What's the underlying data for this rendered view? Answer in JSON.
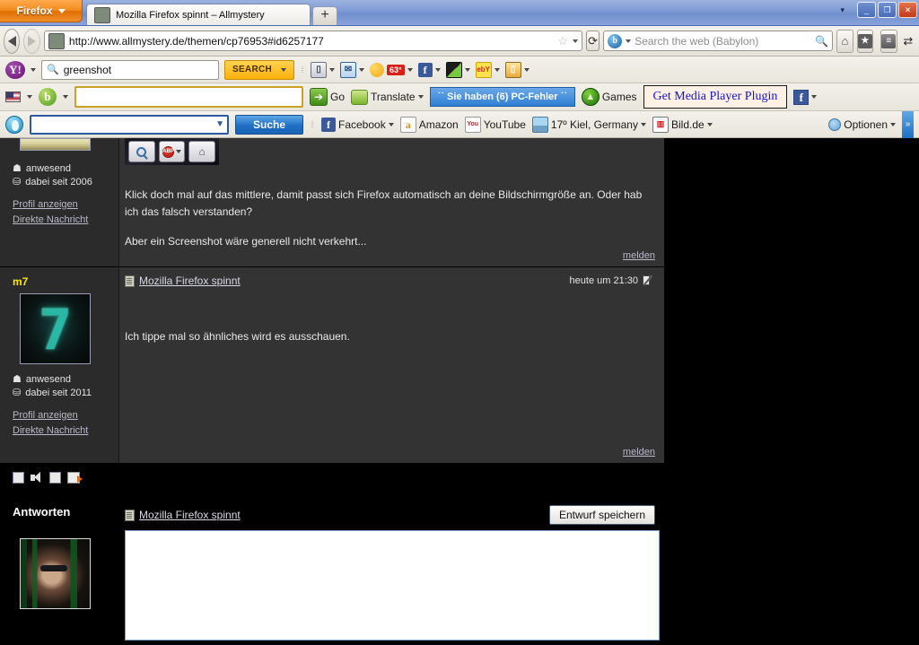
{
  "browser": {
    "app_button": "Firefox",
    "tab_title": "Mozilla Firefox spinnt – Allmystery",
    "new_tab": "+",
    "minimize": "_",
    "maximize": "❐",
    "close": "✕",
    "url": "http://www.allmystery.de/themen/cp76953#id6257177",
    "search_placeholder": "Search the web (Babylon)",
    "search_engine": "b"
  },
  "yahoo_toolbar": {
    "logo": "Y!",
    "query": "greenshot",
    "search_button": "SEARCH",
    "icons": [
      {
        "name": "bookmarks-icon",
        "label": ""
      },
      {
        "name": "mail-icon",
        "label": ""
      },
      {
        "name": "weather-icon",
        "label": "63°"
      },
      {
        "name": "facebook-icon",
        "label": ""
      },
      {
        "name": "photos-icon",
        "label": ""
      },
      {
        "name": "ebay-icon",
        "label": "ebY"
      },
      {
        "name": "shopping-icon",
        "label": ""
      }
    ]
  },
  "babylon_toolbar": {
    "logo": "b",
    "input_value": "",
    "go_label": "Go",
    "translate_label": "Translate",
    "pc_error_banner": "˙˙ Sie haben (6) PC-Fehler ˙˙",
    "games_label": "Games",
    "media_player_plugin": "Get Media Player Plugin",
    "facebook_label": ""
  },
  "allmystery_toolbar": {
    "search_value": "",
    "search_button": "Suche",
    "links": [
      {
        "label": "Facebook",
        "icon": "facebook-icon"
      },
      {
        "label": "Amazon",
        "icon": "amazon-icon"
      },
      {
        "label": "YouTube",
        "icon": "youtube-icon"
      },
      {
        "label": "17º Kiel, Germany",
        "icon": "weather-icon"
      },
      {
        "label": "Bild.de",
        "icon": "bild-icon"
      }
    ],
    "options_label": "Optionen"
  },
  "forum": {
    "posts": [
      {
        "username": "",
        "status": "anwesend",
        "member_since": "dabei seit 2006",
        "profile_link": "Profil anzeigen",
        "message_link": "Direkte Nachricht",
        "title": "",
        "date": "",
        "paragraphs": [
          "Klick doch mal auf das mittlere, damit passt sich Firefox automatisch an deine Bildschirmgröße an. Oder hab ich das falsch verstanden?",
          "Aber ein Screenshot wäre generell nicht verkehrt..."
        ],
        "report_link": "melden"
      },
      {
        "username": "m7",
        "status": "anwesend",
        "member_since": "dabei seit 2011",
        "profile_link": "Profil anzeigen",
        "message_link": "Direkte Nachricht",
        "title": "Mozilla Firefox spinnt",
        "date": "heute um 21:30",
        "paragraphs": [
          "Ich tippe mal so ähnliches wird es ausschauen."
        ],
        "report_link": "melden"
      }
    ]
  },
  "reply": {
    "heading": "Antworten",
    "thread_title": "Mozilla Firefox spinnt",
    "save_draft_button": "Entwurf speichern",
    "editor_value": ""
  },
  "colors": {
    "accent_orange": "#f28b20",
    "titlebar_blue": "#7d99d4",
    "username_yellow": "#ffe700",
    "link_grey": "#b9b9c9",
    "post_bg": "#333333",
    "sidebar_bg": "#2b2b2b"
  }
}
